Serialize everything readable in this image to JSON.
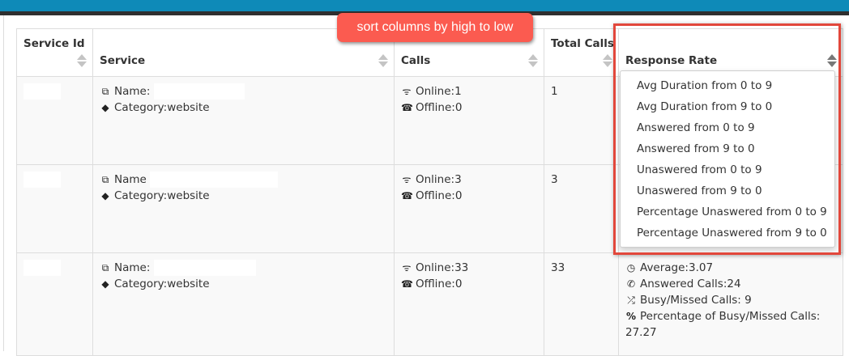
{
  "table": {
    "headers": {
      "service_id": "Service Id",
      "service": "Service",
      "calls": "Calls",
      "total_calls": "Total Calls",
      "response_rate": "Response Rate"
    },
    "rows": [
      {
        "name_label": "Name:",
        "category": "Category:website",
        "online": "Online:1",
        "offline": "Offline:0",
        "total": "1"
      },
      {
        "name_label": "Name",
        "category": "Category:website",
        "online": "Online:3",
        "offline": "Offline:0",
        "total": "3"
      },
      {
        "name_label": "Name:",
        "category": "Category:website",
        "online": "Online:33",
        "offline": "Offline:0",
        "total": "33",
        "response": {
          "average": "Average:3.07",
          "answered": "Answered Calls:24",
          "busy": "Busy/Missed Calls: 9",
          "percentage": "Percentage of Busy/Missed Calls: 27.27"
        }
      }
    ]
  },
  "sort_menu": {
    "items": [
      "Avg Duration from 0 to 9",
      "Avg Duration from 9 to 0",
      "Answered from 0 to 9",
      "Answered from 9 to 0",
      "Unaswered from 0 to 9",
      "Unaswered from 9 to 0",
      "Percentage Unaswered from 0 to 9",
      "Percentage Unaswered from 9 to 0"
    ]
  },
  "annotation": {
    "text": "sort columns by high to low"
  },
  "colors": {
    "topbar": "#0e8ab8",
    "annotation": "#fb5b50",
    "highlight": "#e2473b"
  },
  "icons": [
    "copy-icon",
    "tag-icon",
    "wifi-icon",
    "phone-square-icon",
    "clock-icon",
    "phone-icon",
    "shuffle-icon",
    "percent-icon"
  ]
}
